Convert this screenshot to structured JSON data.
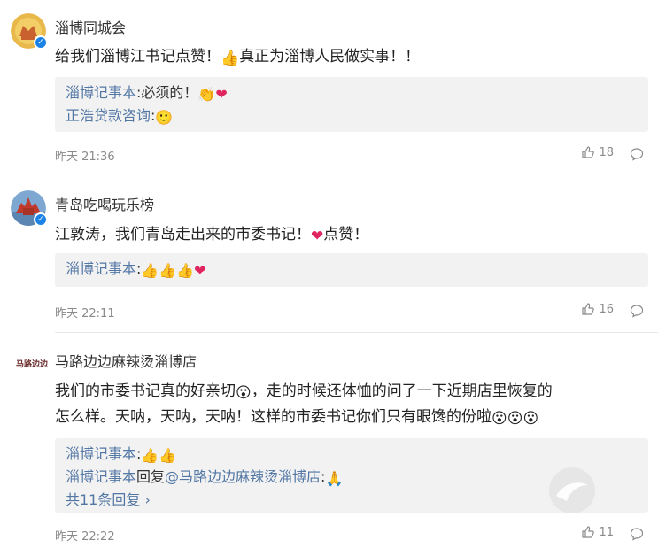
{
  "comments": [
    {
      "user": "淄博同城会",
      "text_prefix": "给我们淄博江书记点赞！",
      "text_suffix": "真正为淄博人民做实事！！",
      "replies": [
        {
          "author": "淄博记事本",
          "sep": ":",
          "text": "必须的！"
        },
        {
          "author": "正浩贷款咨询",
          "sep": ":",
          "text": ""
        }
      ],
      "time": "昨天 21:36",
      "likes": "18"
    },
    {
      "user": "青岛吃喝玩乐榜",
      "text_prefix": "江敦涛，我们青岛走出来的市委书记！",
      "text_suffix": "点赞！",
      "replies": [
        {
          "author": "淄博记事本",
          "sep": ":",
          "text": ""
        }
      ],
      "time": "昨天 22:11",
      "likes": "16"
    },
    {
      "user": "马路边边麻辣烫淄博店",
      "avatar_text": "马路边边",
      "text_line1": "我们的市委书记真的好亲切",
      "text_line1b": "，走的时候还体恤的问了一下近期店里恢复的",
      "text_line2": "怎么样。天呐，天呐，天呐！这样的市委书记你们只有眼馋的份啦",
      "replies": [
        {
          "author": "淄博记事本",
          "sep": ":",
          "text": ""
        },
        {
          "author": "淄博记事本",
          "reply_word": "回复",
          "target": "@马路边边麻辣烫淄博店",
          "sep": ":",
          "text": ""
        }
      ],
      "more_replies": "共11条回复",
      "time": "昨天 22:22",
      "likes": "11"
    }
  ]
}
